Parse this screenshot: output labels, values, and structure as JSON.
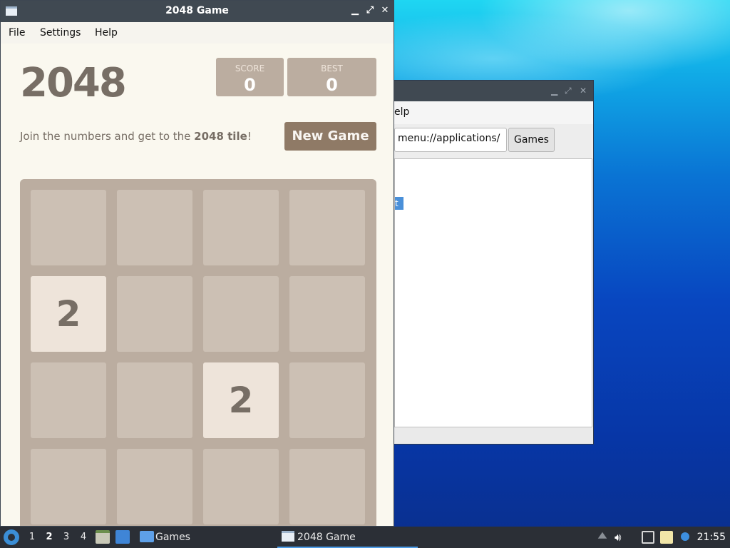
{
  "game_window": {
    "title": "2048 Game",
    "menu": [
      "File",
      "Settings",
      "Help"
    ],
    "heading": "2048",
    "score_label": "SCORE",
    "score_value": "0",
    "best_label": "BEST",
    "best_value": "0",
    "intro_text": "Join the numbers and get to the ",
    "intro_bold": "2048 tile",
    "intro_end": "!",
    "new_game_label": "New Game",
    "board": [
      [
        "",
        "",
        "",
        ""
      ],
      [
        "2",
        "",
        "",
        ""
      ],
      [
        "",
        "",
        "2",
        ""
      ],
      [
        "",
        "",
        "",
        ""
      ]
    ]
  },
  "file_manager": {
    "menu_partial": "elp",
    "path_value": "menu://applications/",
    "path_button": "Games",
    "selected_fragment": "t"
  },
  "taskbar": {
    "desktops": [
      "1",
      "2",
      "3",
      "4"
    ],
    "active_desktop": "2",
    "tasks": [
      {
        "label": "Games",
        "icon": "folder-icon"
      },
      {
        "label": "2048 Game",
        "icon": "window-icon"
      }
    ],
    "clock": "21:55"
  },
  "colors": {
    "tile_bg": "#eee4da",
    "tile_text": "#776e65",
    "board_bg": "#bbada0",
    "button_bg": "#8f7a66",
    "window_bg": "#faf8ef"
  }
}
